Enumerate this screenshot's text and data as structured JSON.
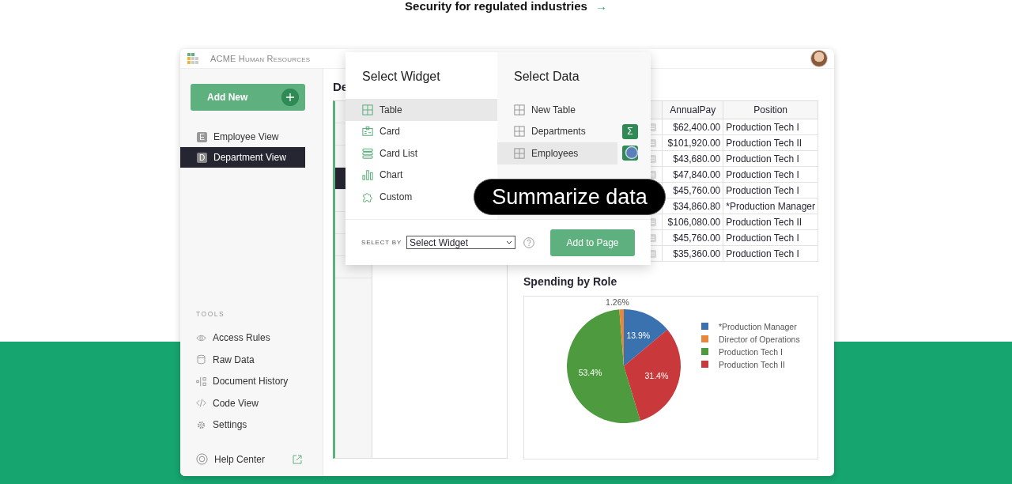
{
  "banner": {
    "text": "Security for regulated industries",
    "arrow": "→"
  },
  "window": {
    "title": "ACME Human Resources"
  },
  "sidebar": {
    "add_button": "Add New",
    "pages": [
      {
        "badge": "E",
        "label": "Employee View",
        "selected": false
      },
      {
        "badge": "D",
        "label": "Department View",
        "selected": true
      }
    ],
    "tools_heading": "TOOLS",
    "tools": [
      {
        "kind": "access",
        "label": "Access Rules"
      },
      {
        "kind": "raw",
        "label": "Raw Data"
      },
      {
        "kind": "history",
        "label": "Document History"
      },
      {
        "kind": "code",
        "label": "Code View"
      },
      {
        "kind": "settings",
        "label": "Settings"
      }
    ],
    "help": {
      "label": "Help Center"
    }
  },
  "page_title": "De",
  "table": {
    "columns": [
      "AnnualPay",
      "Position"
    ],
    "rows": [
      [
        "$62,400.00",
        "Production Tech I"
      ],
      [
        "$101,920.00",
        "Production Tech II"
      ],
      [
        "$43,680.00",
        "Production Tech I"
      ],
      [
        "$47,840.00",
        "Production Tech I"
      ],
      [
        "$45,760.00",
        "Production Tech I"
      ],
      [
        "$34,860.80",
        "*Production Manager"
      ],
      [
        "$106,080.00",
        "Production Tech II"
      ],
      [
        "$45,760.00",
        "Production Tech I"
      ],
      [
        "$35,360.00",
        "Production Tech I"
      ]
    ]
  },
  "chart_section": {
    "title": "Spending by Role",
    "chart_data": {
      "type": "pie",
      "categories": [
        "*Production Manager",
        "Director of Operations",
        "Production Tech I",
        "Production Tech II"
      ],
      "values": [
        13.9,
        1.26,
        53.4,
        31.4
      ],
      "colors": [
        "#3a72b0",
        "#e8873a",
        "#4e9a3f",
        "#c9383a"
      ],
      "value_labels": [
        "13.9%",
        "1.26%",
        "53.4%",
        "31.4%"
      ],
      "legend": "right"
    }
  },
  "popup": {
    "widget_title": "Select Widget",
    "data_title": "Select Data",
    "widgets": [
      {
        "kind": "table",
        "label": "Table",
        "selected": true
      },
      {
        "kind": "card",
        "label": "Card",
        "selected": false
      },
      {
        "kind": "cardlist",
        "label": "Card List",
        "selected": false
      },
      {
        "kind": "chart",
        "label": "Chart",
        "selected": false
      },
      {
        "kind": "custom",
        "label": "Custom",
        "selected": false
      }
    ],
    "data": [
      {
        "label": "New Table",
        "selected": false,
        "summary_button": false
      },
      {
        "label": "Departments",
        "selected": false,
        "summary_button": true,
        "summary_icon": "Σ"
      },
      {
        "label": "Employees",
        "selected": true,
        "summary_button": true
      }
    ],
    "select_by_label": "SELECT BY",
    "select_by_value": "Select Widget",
    "add_button": "Add to Page"
  },
  "tooltip": "Summarize data"
}
